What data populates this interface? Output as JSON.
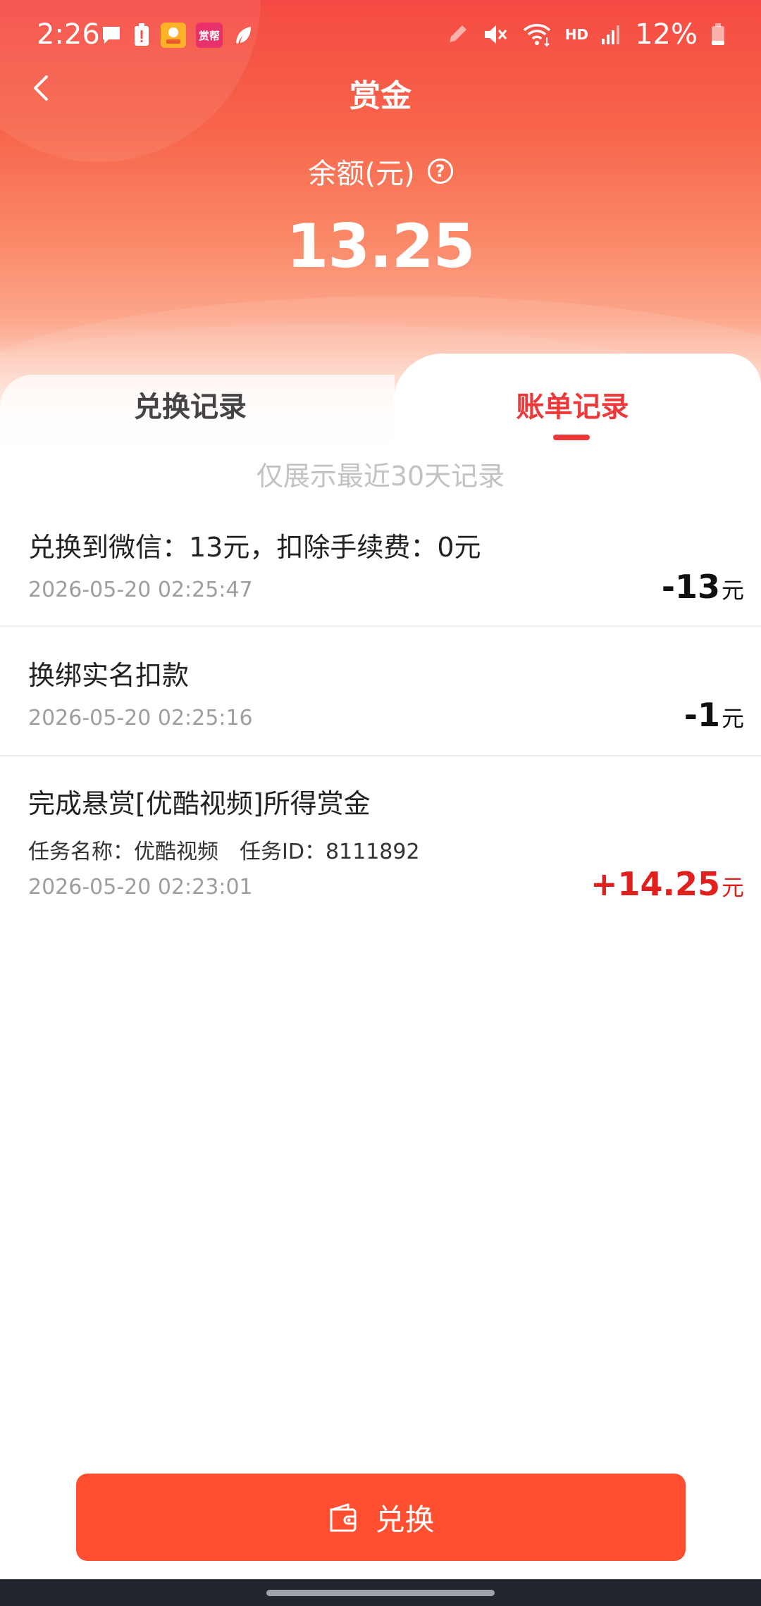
{
  "status_bar": {
    "time": "2:26",
    "notification_icons": [
      "message-icon",
      "battery-alert-icon",
      "app-icon-1",
      "app-icon-zanbang",
      "feather-icon"
    ],
    "zanbang_badge": "赏帮",
    "right_icons": [
      "pencil-icon",
      "mute-icon",
      "wifi-icon",
      "hd-icon",
      "signal-icon",
      "battery-icon"
    ],
    "hd_text": "HD",
    "battery": "12%"
  },
  "nav": {
    "title": "赏金"
  },
  "balance": {
    "label": "余额(元)",
    "help": "?",
    "value": "13.25"
  },
  "tabs": [
    {
      "label": "兑换记录",
      "active": false
    },
    {
      "label": "账单记录",
      "active": true
    }
  ],
  "notice": "仅展示最近30天记录",
  "records": [
    {
      "title": "兑换到微信：13元，扣除手续费：0元",
      "time": "2026-05-20 02:25:47",
      "amount": "-13",
      "unit": "元"
    },
    {
      "title": "换绑实名扣款",
      "time": "2026-05-20 02:25:16",
      "amount": "-1",
      "unit": "元"
    },
    {
      "title": "完成悬赏[优酷视频]所得赏金",
      "sub": "任务名称：优酷视频　任务ID：8111892",
      "time": "2026-05-20 02:23:01",
      "amount": "+14.25",
      "unit": "元"
    }
  ],
  "bottom_button": {
    "label": "兑换",
    "icon": "wallet-icon"
  },
  "colors": {
    "header_top": "#f54a43",
    "accent": "#ec3838",
    "positive_amount": "#e0201d",
    "button": "#ff4f30"
  }
}
